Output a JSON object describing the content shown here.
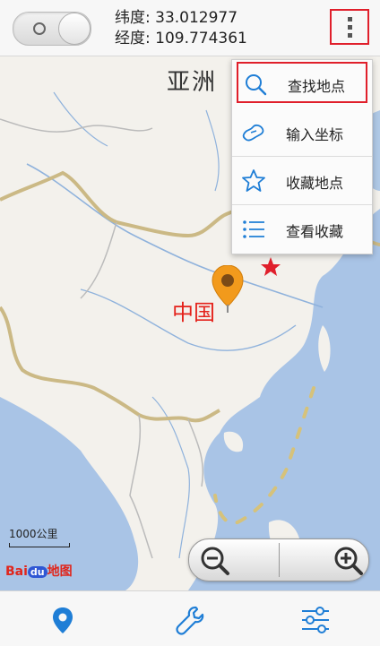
{
  "header": {
    "latitude_label": "纬度: 33.012977",
    "longitude_label": "经度: 109.774361"
  },
  "map": {
    "continent_label": "亚洲",
    "country_label": "中国",
    "scale_label": "1000公里",
    "logo": {
      "part1": "Bai",
      "part2": "du",
      "part3": "地图"
    }
  },
  "menu": {
    "items": [
      {
        "label": "查找地点",
        "icon": "search-icon"
      },
      {
        "label": "输入坐标",
        "icon": "map-icon"
      },
      {
        "label": "收藏地点",
        "icon": "star-icon"
      },
      {
        "label": "查看收藏",
        "icon": "list-icon"
      }
    ]
  },
  "bottom_nav": [
    {
      "icon": "location-pin-icon",
      "active": true
    },
    {
      "icon": "wrench-icon",
      "active": false
    },
    {
      "icon": "sliders-icon",
      "active": false
    }
  ],
  "colors": {
    "accent": "#1f7ed6",
    "highlight": "#e01f2b",
    "pin": "#f29a1c",
    "sea": "#a9c4e6",
    "land": "#f3f1ec"
  }
}
